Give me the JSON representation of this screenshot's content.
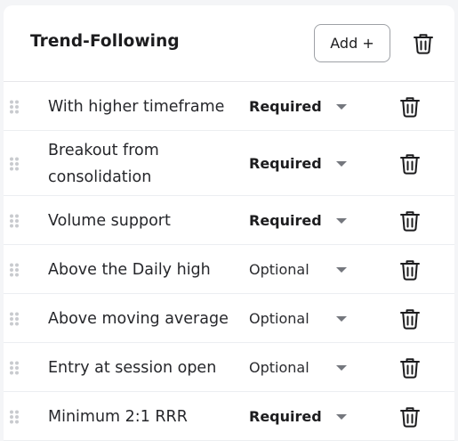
{
  "header": {
    "title": "Trend-Following",
    "add_label": "Add +"
  },
  "rows": [
    {
      "label": "With higher timeframe",
      "status": "Required"
    },
    {
      "label": "Breakout from consolidation",
      "status": "Required"
    },
    {
      "label": "Volume support",
      "status": "Required"
    },
    {
      "label": "Above the Daily high",
      "status": "Optional"
    },
    {
      "label": "Above moving average",
      "status": "Optional"
    },
    {
      "label": "Entry at session open",
      "status": "Optional"
    },
    {
      "label": "Minimum 2:1 RRR",
      "status": "Required"
    }
  ],
  "icons": {
    "delete": "trash-icon",
    "drag": "drag-handle-icon",
    "dropdown": "caret-down-icon"
  },
  "colors": {
    "text": "#1c1c1e",
    "muted_icon": "#c9cbcf",
    "caret": "#74777d",
    "border": "#e6e7ea"
  }
}
